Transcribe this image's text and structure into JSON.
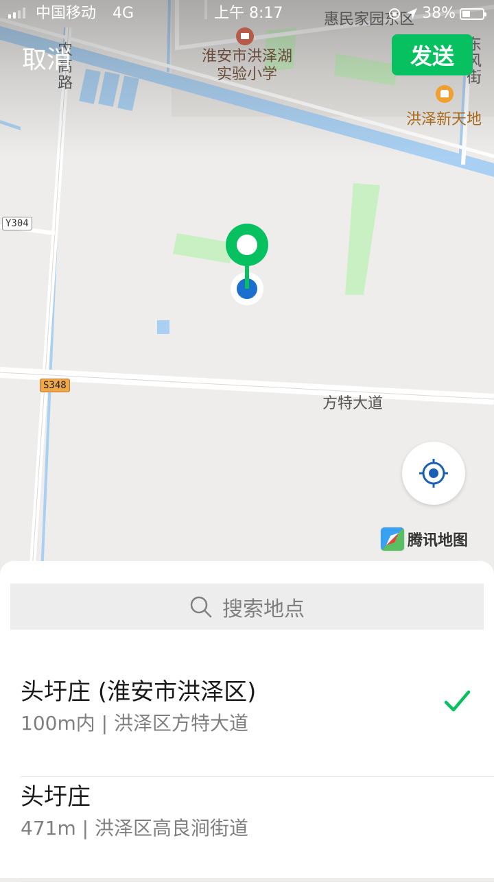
{
  "status_bar": {
    "carrier": "中国移动",
    "network": "4G",
    "time": "上午 8:17",
    "battery": "38%",
    "battery_fraction": 0.38
  },
  "header": {
    "cancel_label": "取消",
    "send_label": "发送"
  },
  "map": {
    "labels": {
      "community": "惠民家园东区",
      "road_nongao": "农高路",
      "road_dongfeng": "东风街",
      "school": "淮安市洪泽湖实验小学",
      "plaza": "洪泽新天地",
      "avenue": "方特大道",
      "road_y304": "Y304",
      "road_s348": "S348"
    },
    "provider": "腾讯地图"
  },
  "colors": {
    "accent_green": "#07c160",
    "location_blue": "#1a6fcf",
    "water": "#a9d0f2",
    "park": "#c9f0c2"
  },
  "search": {
    "placeholder": "搜索地点"
  },
  "results": [
    {
      "title": "头圩庄 (淮安市洪泽区)",
      "subtitle": "100m内 | 洪泽区方特大道",
      "selected": true
    },
    {
      "title": "头圩庄",
      "subtitle": "471m | 洪泽区高良涧街道",
      "selected": false
    }
  ]
}
